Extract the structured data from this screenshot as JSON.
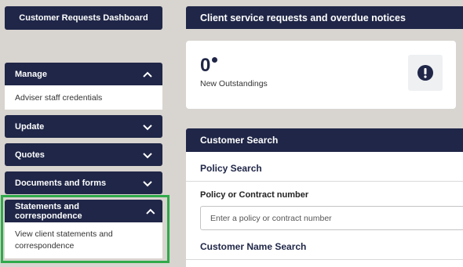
{
  "sidebar": {
    "dashboard_label": "Customer Requests Dashboard",
    "sections": [
      {
        "label": "Manage",
        "expanded": true,
        "links": [
          "Adviser staff credentials"
        ]
      },
      {
        "label": "Update",
        "expanded": false
      },
      {
        "label": "Quotes",
        "expanded": false
      },
      {
        "label": "Documents and forms",
        "expanded": false
      },
      {
        "label": "Statements and correspondence",
        "expanded": true,
        "links": [
          "View client statements and correspondence"
        ]
      }
    ]
  },
  "main": {
    "header_title": "Client service requests and overdue notices",
    "outstanding": {
      "count": "0",
      "label": "New Outstandings"
    },
    "customer_search": {
      "title": "Customer Search",
      "policy_search_title": "Policy Search",
      "policy_field_label": "Policy or Contract number",
      "policy_field_placeholder": "Enter a policy or contract number",
      "policy_field_value": "",
      "name_search_title": "Customer Name Search"
    }
  },
  "colors": {
    "navy": "#1f2647",
    "highlight": "#2faa4a",
    "page_background": "#d8d4cf"
  },
  "icons": {
    "expanded": "chevron-up-icon",
    "collapsed": "chevron-down-icon",
    "alert": "exclamation-circle-icon"
  }
}
